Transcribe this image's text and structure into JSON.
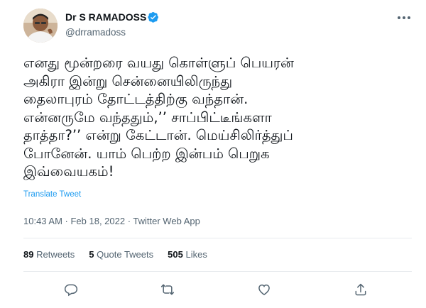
{
  "author": {
    "name": "Dr S RAMADOSS",
    "handle": "@drramadoss",
    "verified": true
  },
  "tweet": {
    "text": "எனது மூன்றரை வயது கொள்ளுப் பெயரன்\nஅகிரா இன்று சென்னையிலிருந்து\nதைலாபுரம் தோட்டத்திற்கு வந்தான்.\nஎன்னருமே வந்ததும்,’’ சாப்பிட்டீங்களா\nதாத்தா?’’ என்று கேட்டான். மெய்சிலிர்த்துப்\nபோனேன்.  யாம் பெற்ற இன்பம் பெறுக\nஇவ்வையகம்!",
    "translate_label": "Translate Tweet",
    "timestamp": "10:43 AM · Feb 18, 2022 · Twitter Web App"
  },
  "stats": {
    "retweets_count": "89",
    "retweets_label": "Retweets",
    "quotes_count": "5",
    "quotes_label": "Quote Tweets",
    "likes_count": "505",
    "likes_label": "Likes"
  },
  "actions": {
    "icons": [
      "reply-icon",
      "retweet-icon",
      "like-icon",
      "share-icon"
    ]
  },
  "colors": {
    "text": "#0f1419",
    "secondary": "#536471",
    "accent": "#1d9bf0",
    "divider": "#e7ebee"
  }
}
